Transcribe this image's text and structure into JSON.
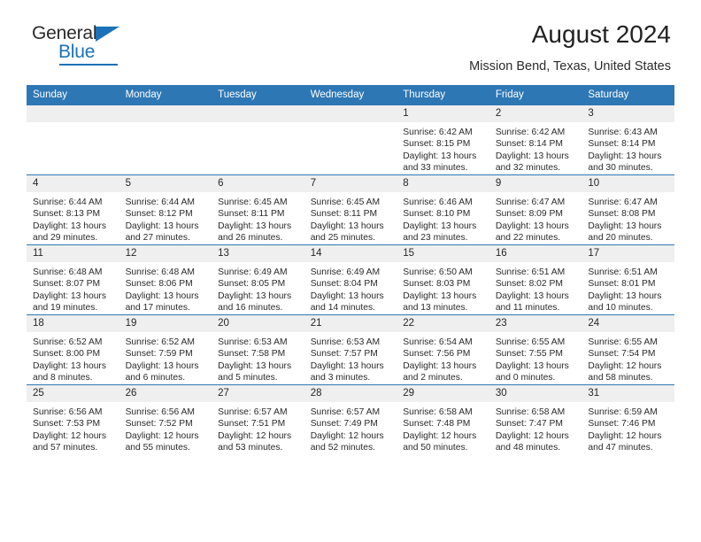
{
  "brand": {
    "name_primary": "General",
    "name_secondary": "Blue"
  },
  "header": {
    "title": "August 2024",
    "subtitle": "Mission Bend, Texas, United States"
  },
  "calendar": {
    "weekday_headers": [
      "Sunday",
      "Monday",
      "Tuesday",
      "Wednesday",
      "Thursday",
      "Friday",
      "Saturday"
    ],
    "accent_color": "#2e77b5",
    "daynum_band_color": "#efefef",
    "weeks": [
      [
        {
          "day": "",
          "lines": []
        },
        {
          "day": "",
          "lines": []
        },
        {
          "day": "",
          "lines": []
        },
        {
          "day": "",
          "lines": []
        },
        {
          "day": "1",
          "lines": [
            "Sunrise: 6:42 AM",
            "Sunset: 8:15 PM",
            "Daylight: 13 hours",
            "and 33 minutes."
          ]
        },
        {
          "day": "2",
          "lines": [
            "Sunrise: 6:42 AM",
            "Sunset: 8:14 PM",
            "Daylight: 13 hours",
            "and 32 minutes."
          ]
        },
        {
          "day": "3",
          "lines": [
            "Sunrise: 6:43 AM",
            "Sunset: 8:14 PM",
            "Daylight: 13 hours",
            "and 30 minutes."
          ]
        }
      ],
      [
        {
          "day": "4",
          "lines": [
            "Sunrise: 6:44 AM",
            "Sunset: 8:13 PM",
            "Daylight: 13 hours",
            "and 29 minutes."
          ]
        },
        {
          "day": "5",
          "lines": [
            "Sunrise: 6:44 AM",
            "Sunset: 8:12 PM",
            "Daylight: 13 hours",
            "and 27 minutes."
          ]
        },
        {
          "day": "6",
          "lines": [
            "Sunrise: 6:45 AM",
            "Sunset: 8:11 PM",
            "Daylight: 13 hours",
            "and 26 minutes."
          ]
        },
        {
          "day": "7",
          "lines": [
            "Sunrise: 6:45 AM",
            "Sunset: 8:11 PM",
            "Daylight: 13 hours",
            "and 25 minutes."
          ]
        },
        {
          "day": "8",
          "lines": [
            "Sunrise: 6:46 AM",
            "Sunset: 8:10 PM",
            "Daylight: 13 hours",
            "and 23 minutes."
          ]
        },
        {
          "day": "9",
          "lines": [
            "Sunrise: 6:47 AM",
            "Sunset: 8:09 PM",
            "Daylight: 13 hours",
            "and 22 minutes."
          ]
        },
        {
          "day": "10",
          "lines": [
            "Sunrise: 6:47 AM",
            "Sunset: 8:08 PM",
            "Daylight: 13 hours",
            "and 20 minutes."
          ]
        }
      ],
      [
        {
          "day": "11",
          "lines": [
            "Sunrise: 6:48 AM",
            "Sunset: 8:07 PM",
            "Daylight: 13 hours",
            "and 19 minutes."
          ]
        },
        {
          "day": "12",
          "lines": [
            "Sunrise: 6:48 AM",
            "Sunset: 8:06 PM",
            "Daylight: 13 hours",
            "and 17 minutes."
          ]
        },
        {
          "day": "13",
          "lines": [
            "Sunrise: 6:49 AM",
            "Sunset: 8:05 PM",
            "Daylight: 13 hours",
            "and 16 minutes."
          ]
        },
        {
          "day": "14",
          "lines": [
            "Sunrise: 6:49 AM",
            "Sunset: 8:04 PM",
            "Daylight: 13 hours",
            "and 14 minutes."
          ]
        },
        {
          "day": "15",
          "lines": [
            "Sunrise: 6:50 AM",
            "Sunset: 8:03 PM",
            "Daylight: 13 hours",
            "and 13 minutes."
          ]
        },
        {
          "day": "16",
          "lines": [
            "Sunrise: 6:51 AM",
            "Sunset: 8:02 PM",
            "Daylight: 13 hours",
            "and 11 minutes."
          ]
        },
        {
          "day": "17",
          "lines": [
            "Sunrise: 6:51 AM",
            "Sunset: 8:01 PM",
            "Daylight: 13 hours",
            "and 10 minutes."
          ]
        }
      ],
      [
        {
          "day": "18",
          "lines": [
            "Sunrise: 6:52 AM",
            "Sunset: 8:00 PM",
            "Daylight: 13 hours",
            "and 8 minutes."
          ]
        },
        {
          "day": "19",
          "lines": [
            "Sunrise: 6:52 AM",
            "Sunset: 7:59 PM",
            "Daylight: 13 hours",
            "and 6 minutes."
          ]
        },
        {
          "day": "20",
          "lines": [
            "Sunrise: 6:53 AM",
            "Sunset: 7:58 PM",
            "Daylight: 13 hours",
            "and 5 minutes."
          ]
        },
        {
          "day": "21",
          "lines": [
            "Sunrise: 6:53 AM",
            "Sunset: 7:57 PM",
            "Daylight: 13 hours",
            "and 3 minutes."
          ]
        },
        {
          "day": "22",
          "lines": [
            "Sunrise: 6:54 AM",
            "Sunset: 7:56 PM",
            "Daylight: 13 hours",
            "and 2 minutes."
          ]
        },
        {
          "day": "23",
          "lines": [
            "Sunrise: 6:55 AM",
            "Sunset: 7:55 PM",
            "Daylight: 13 hours",
            "and 0 minutes."
          ]
        },
        {
          "day": "24",
          "lines": [
            "Sunrise: 6:55 AM",
            "Sunset: 7:54 PM",
            "Daylight: 12 hours",
            "and 58 minutes."
          ]
        }
      ],
      [
        {
          "day": "25",
          "lines": [
            "Sunrise: 6:56 AM",
            "Sunset: 7:53 PM",
            "Daylight: 12 hours",
            "and 57 minutes."
          ]
        },
        {
          "day": "26",
          "lines": [
            "Sunrise: 6:56 AM",
            "Sunset: 7:52 PM",
            "Daylight: 12 hours",
            "and 55 minutes."
          ]
        },
        {
          "day": "27",
          "lines": [
            "Sunrise: 6:57 AM",
            "Sunset: 7:51 PM",
            "Daylight: 12 hours",
            "and 53 minutes."
          ]
        },
        {
          "day": "28",
          "lines": [
            "Sunrise: 6:57 AM",
            "Sunset: 7:49 PM",
            "Daylight: 12 hours",
            "and 52 minutes."
          ]
        },
        {
          "day": "29",
          "lines": [
            "Sunrise: 6:58 AM",
            "Sunset: 7:48 PM",
            "Daylight: 12 hours",
            "and 50 minutes."
          ]
        },
        {
          "day": "30",
          "lines": [
            "Sunrise: 6:58 AM",
            "Sunset: 7:47 PM",
            "Daylight: 12 hours",
            "and 48 minutes."
          ]
        },
        {
          "day": "31",
          "lines": [
            "Sunrise: 6:59 AM",
            "Sunset: 7:46 PM",
            "Daylight: 12 hours",
            "and 47 minutes."
          ]
        }
      ]
    ]
  }
}
